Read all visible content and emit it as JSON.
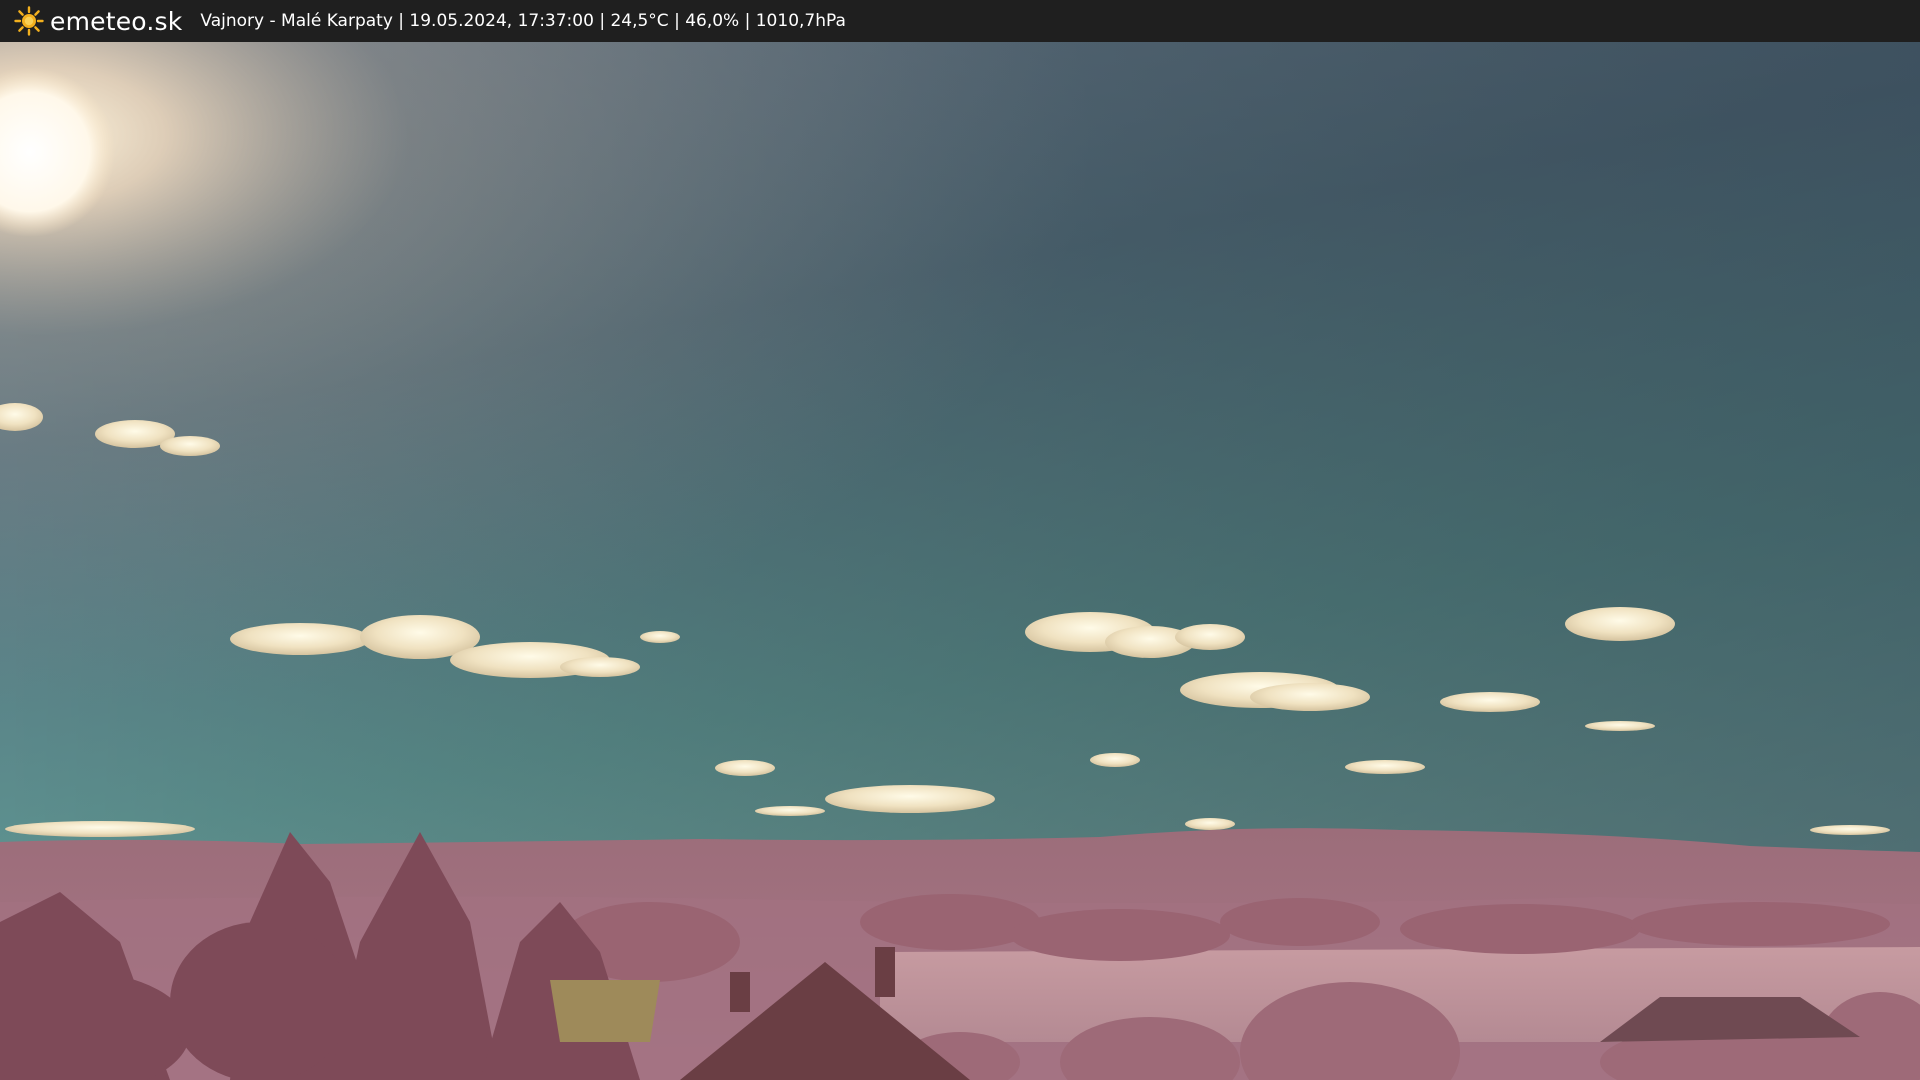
{
  "app": {
    "brand": "emeteo.sk",
    "logo_icon": "sun-icon"
  },
  "webcam": {
    "caption": "Vajnory - Malé Karpaty | 19.05.2024, 17:37:00 | 24,5°C | 46,0% | 1010,7hPa"
  },
  "colors": {
    "topbar": "#1f1f1f",
    "text": "#ffffff",
    "logo_sun": "#f2b01e"
  }
}
